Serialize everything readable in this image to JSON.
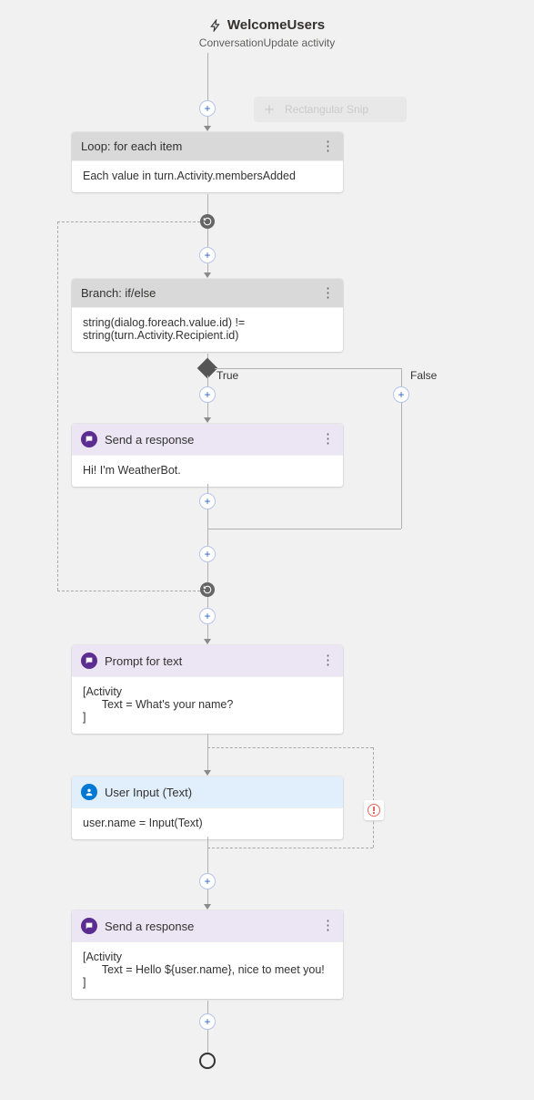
{
  "trigger": {
    "name": "WelcomeUsers",
    "subtitle": "ConversationUpdate activity"
  },
  "snip": {
    "label": "Rectangular Snip"
  },
  "loop": {
    "title": "Loop: for each item",
    "body": "Each value in turn.Activity.membersAdded"
  },
  "branch": {
    "title": "Branch: if/else",
    "body": "string(dialog.foreach.value.id) != string(turn.Activity.Recipient.id)",
    "trueLabel": "True",
    "falseLabel": "False"
  },
  "send1": {
    "title": "Send a response",
    "body": "Hi! I'm WeatherBot."
  },
  "prompt": {
    "title": "Prompt for text",
    "body": "[Activity\n      Text = What's your name?\n]"
  },
  "userInput": {
    "title": "User Input (Text)",
    "body": "user.name = Input(Text)"
  },
  "send2": {
    "title": "Send a response",
    "body": "[Activity\n      Text = Hello ${user.name}, nice to meet you!\n]"
  },
  "icons": {
    "bolt": "bolt-icon",
    "chat": "chat-icon",
    "user": "user-icon",
    "kebab": "kebab-icon",
    "plus": "plus-icon",
    "loop": "loop-icon",
    "error": "error-icon"
  }
}
